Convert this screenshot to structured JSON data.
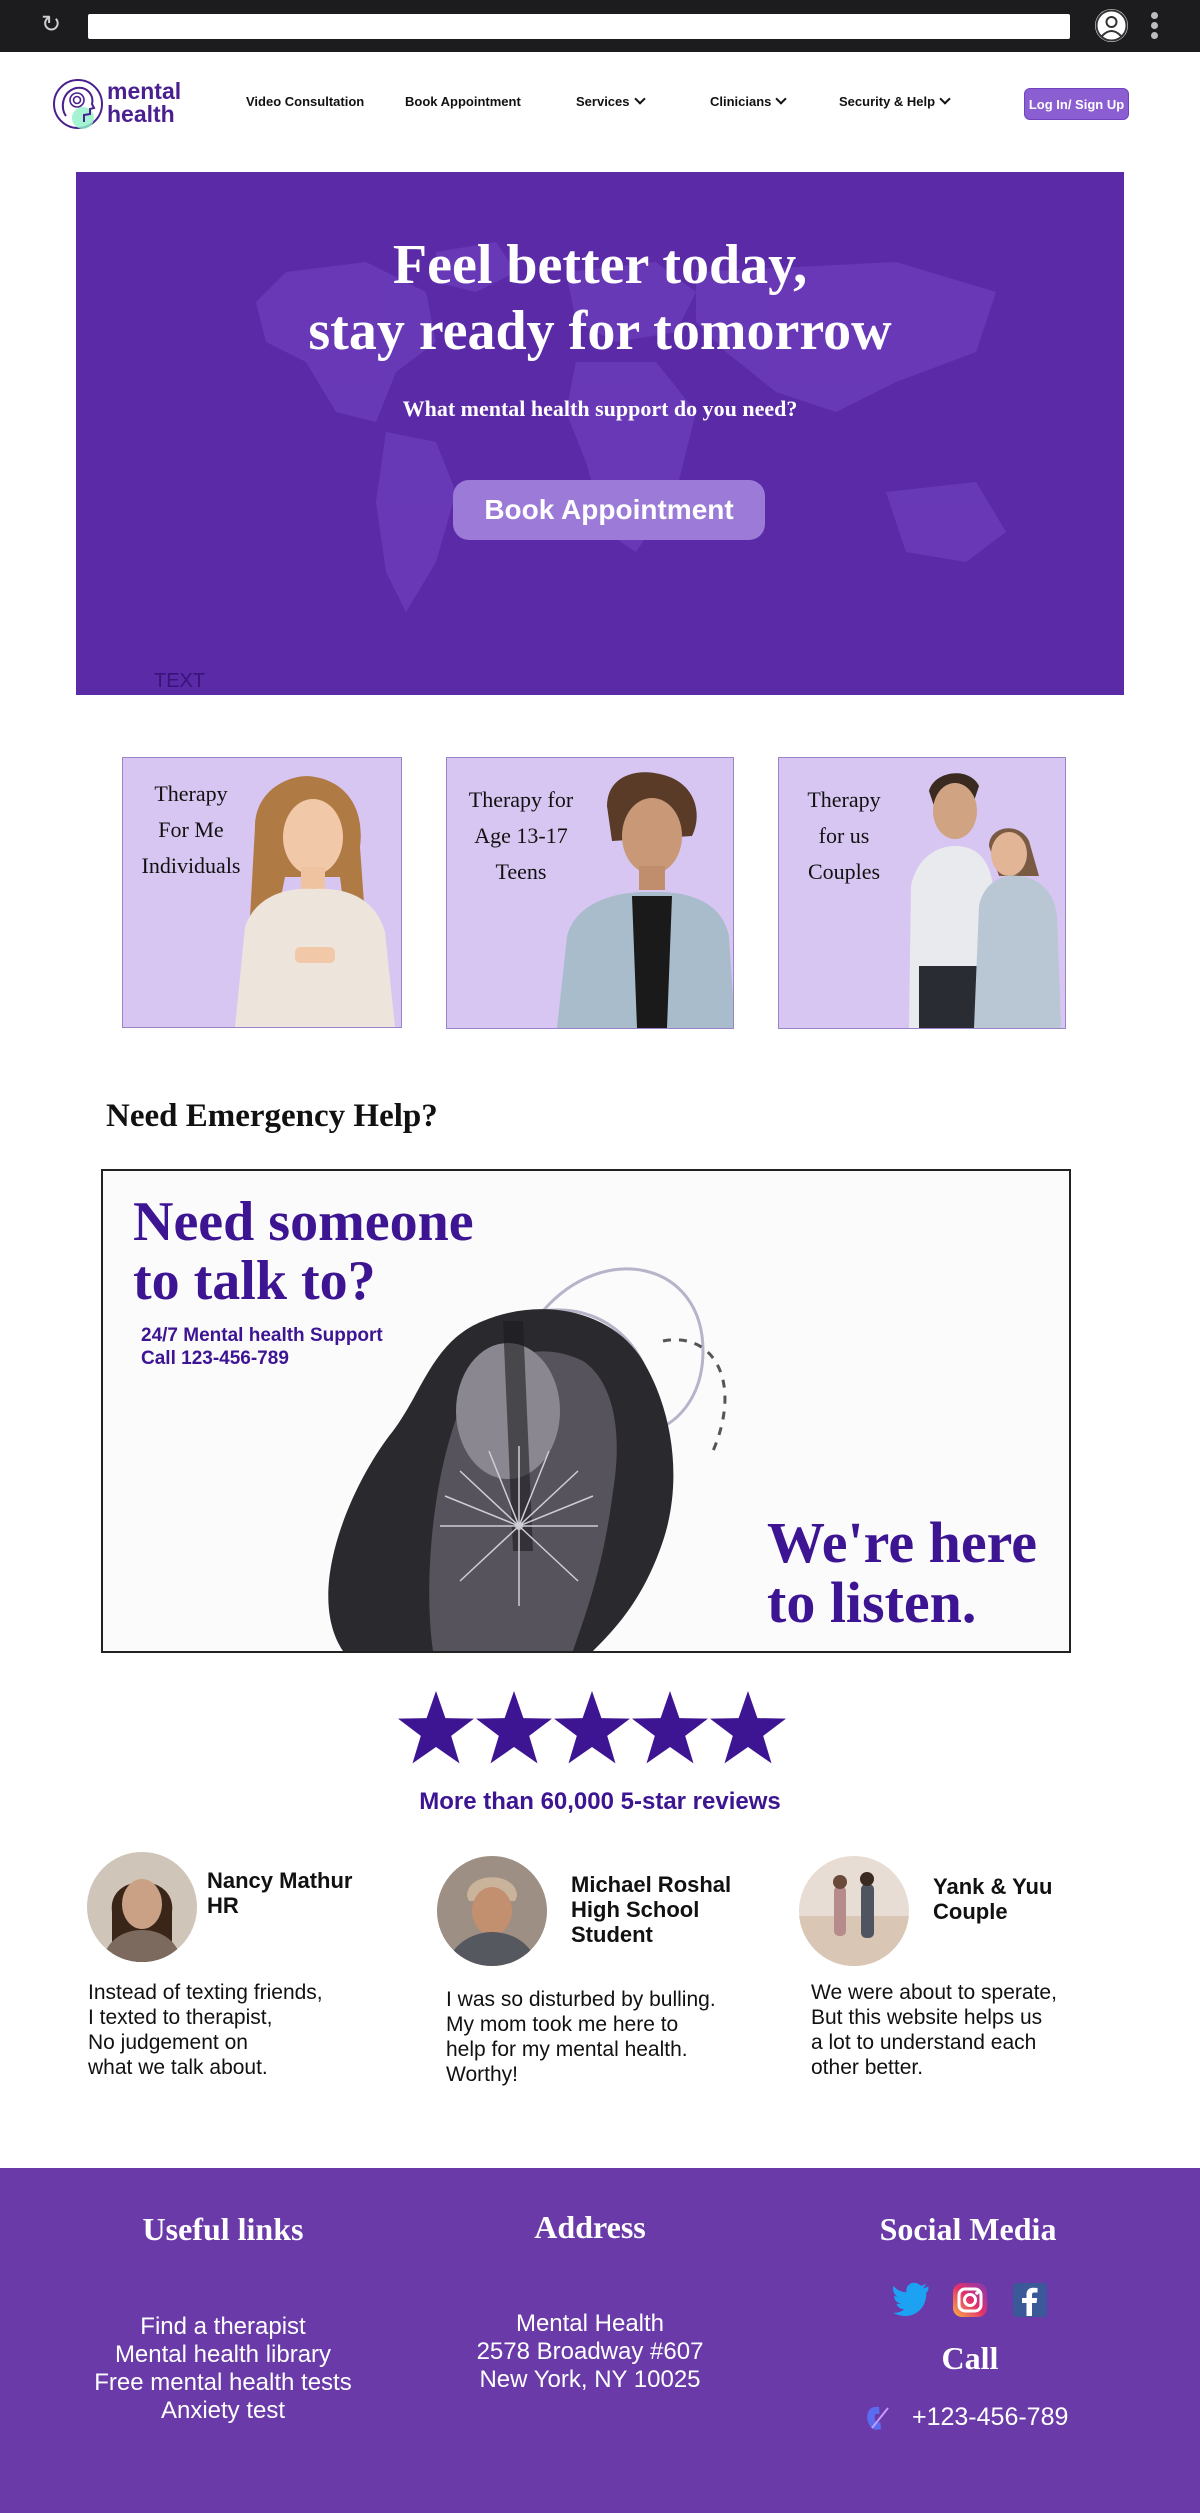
{
  "logo": {
    "line1": "mental",
    "line2": "health"
  },
  "nav": {
    "items": [
      {
        "label": "Video Consultation"
      },
      {
        "label": "Book Appointment"
      },
      {
        "label": "Services"
      },
      {
        "label": "Clinicians"
      },
      {
        "label": "Security & Help"
      }
    ],
    "login_label": "Log In/ Sign Up"
  },
  "hero": {
    "title_line1": "Feel better today,",
    "title_line2": "stay ready for tomorrow",
    "subtitle": "What mental health support do you need?",
    "button_label": "Book Appointment",
    "placeholder_text": "TEXT",
    "bg_color": "#5b2aa7"
  },
  "cards": [
    {
      "line1": "Therapy",
      "line2": "For Me",
      "line3": "Individuals"
    },
    {
      "line1": "Therapy for",
      "line2": "Age 13-17",
      "line3": "Teens"
    },
    {
      "line1": "Therapy",
      "line2": "for us",
      "line3": "Couples"
    }
  ],
  "emergency": {
    "title": "Need Emergency Help?",
    "banner_line1": "Need someone",
    "banner_line2": "to talk to?",
    "support_line": "24/7 Mental health Support",
    "call_line": "Call 123-456-789",
    "listen_line1": "We're here",
    "listen_line2": "to listen."
  },
  "reviews": {
    "stars": 5,
    "summary": "More than 60,000 5-star reviews",
    "testimonials": [
      {
        "name_line1": "Nancy Mathur",
        "name_line2": "HR",
        "name_line3": "",
        "quote": [
          "Instead of texting friends,",
          "I texted to therapist,",
          "No judgement on",
          "what we talk about."
        ]
      },
      {
        "name_line1": "Michael Roshal",
        "name_line2": "High School",
        "name_line3": "Student",
        "quote": [
          "I was so disturbed by bulling.",
          "My mom took me here to",
          "help for my mental health.",
          "Worthy!"
        ]
      },
      {
        "name_line1": "Yank & Yuu",
        "name_line2": "Couple",
        "name_line3": "",
        "quote": [
          "We were about to sperate,",
          "But this website helps us",
          "a lot to understand each",
          "other better."
        ]
      }
    ]
  },
  "footer": {
    "links_title": "Useful links",
    "links": [
      "Find a therapist",
      "Mental health library",
      "Free mental health tests",
      "Anxiety test"
    ],
    "address_title": "Address",
    "address": [
      "Mental Health",
      "2578 Broadway #607",
      "New York, NY 10025"
    ],
    "social_title": "Social Media",
    "social_icons": [
      "twitter-icon",
      "instagram-icon",
      "facebook-icon"
    ],
    "call_title": "Call",
    "phone": "+123-456-789",
    "bg_color": "#6a3aa8"
  },
  "colors": {
    "accent": "#5b2aa7",
    "brand_text": "#3d1593",
    "card_bg": "#d8c6f2",
    "button": "#8b5fd1"
  }
}
